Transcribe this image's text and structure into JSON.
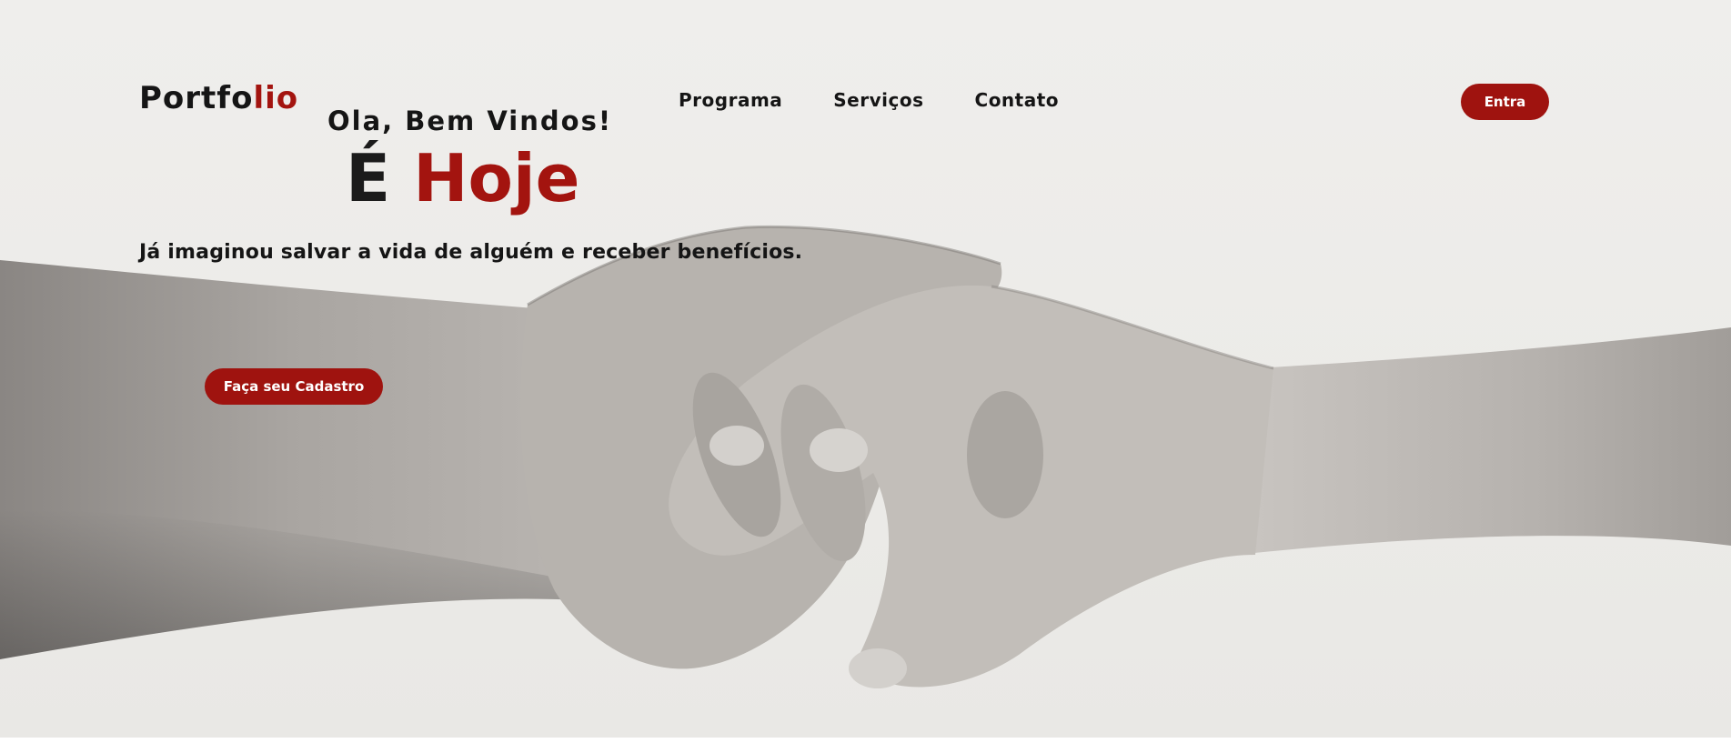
{
  "header": {
    "logo_main": "Portfo",
    "logo_accent": "lio",
    "nav": [
      {
        "label": "Programa"
      },
      {
        "label": "Serviços"
      },
      {
        "label": "Contato"
      }
    ],
    "login_label": "Entra"
  },
  "hero": {
    "greeting": "Ola, Bem Vindos!",
    "headline_main": "É",
    "headline_accent": "Hoje",
    "tagline": "Já imaginou salvar a vida de alguém e receber benefícios.",
    "cta_label": "Faça seu Cadastro",
    "image_icon": "handshake-icon"
  },
  "colors": {
    "accent": "#a3140f",
    "text": "#151515",
    "background": "#eeedeb"
  }
}
